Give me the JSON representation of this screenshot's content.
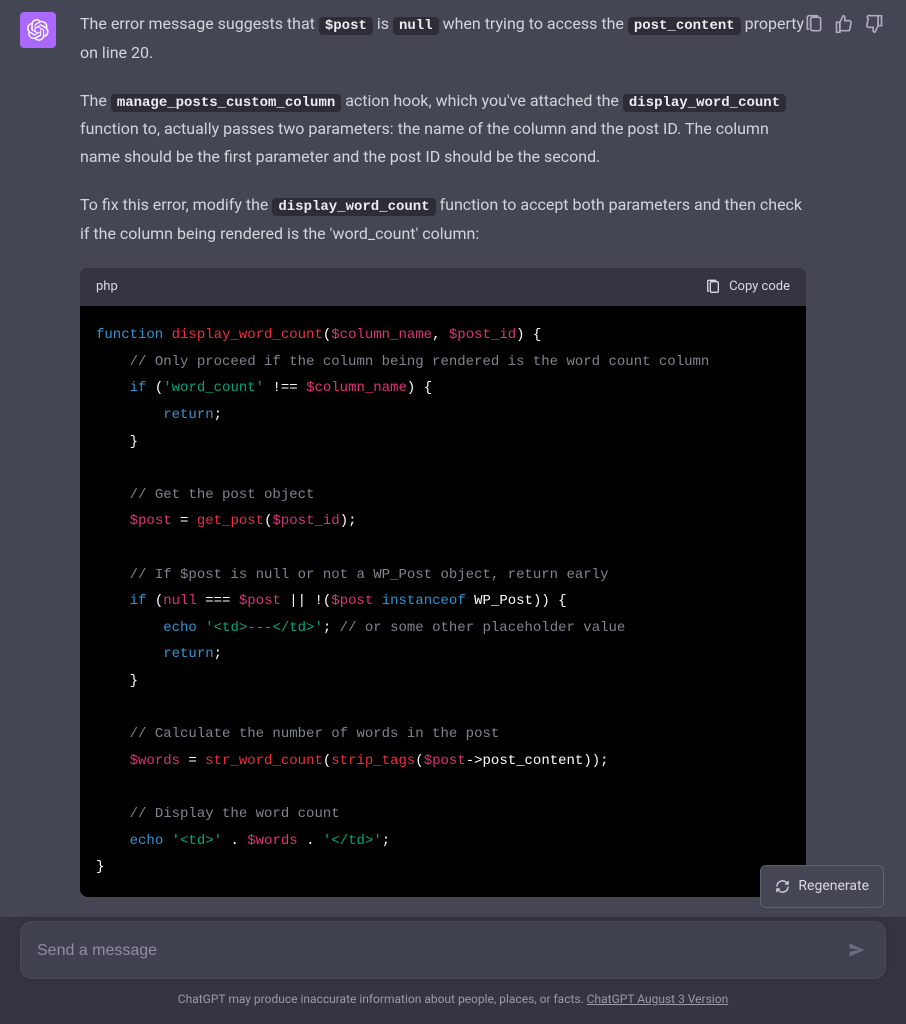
{
  "message": {
    "p1_a": "The error message suggests that ",
    "p1_code1": "$post",
    "p1_b": " is ",
    "p1_code2": "null",
    "p1_c": " when trying to access the ",
    "p1_code3": "post_content",
    "p1_d": " property on line 20.",
    "p2_a": "The ",
    "p2_code1": "manage_posts_custom_column",
    "p2_b": " action hook, which you've attached the ",
    "p2_code2": "display_word_count",
    "p2_c": " function to, actually passes two parameters: the name of the column and the post ID. The column name should be the first parameter and the post ID should be the second.",
    "p3_a": "To fix this error, modify the ",
    "p3_code1": "display_word_count",
    "p3_b": " function to accept both parameters and then check if the column being rendered is the 'word_count' column:"
  },
  "code_block": {
    "language": "php",
    "copy_label": "Copy code",
    "tokens": {
      "l1_kw": "function",
      "l1_fn": "display_word_count",
      "l1_v1": "$column_name",
      "l1_v2": "$post_id",
      "l2_cm": "// Only proceed if the column being rendered is the word count column",
      "l3_kw": "if",
      "l3_str": "'word_count'",
      "l3_var": "$column_name",
      "l4_kw": "return",
      "l6_cm": "// Get the post object",
      "l7_v1": "$post",
      "l7_fn": "get_post",
      "l7_v2": "$post_id",
      "l8_cm": "// If $post is null or not a WP_Post object, return early",
      "l9_kw": "if",
      "l9_null": "null",
      "l9_v1": "$post",
      "l9_v2": "$post",
      "l9_iof": "instanceof",
      "l9_cls": "WP_Post",
      "l10_echo": "echo",
      "l10_str": "'<td>---</td>'",
      "l10_cm": "// or some other placeholder value",
      "l11_kw": "return",
      "l13_cm": "// Calculate the number of words in the post",
      "l14_v1": "$words",
      "l14_fn1": "str_word_count",
      "l14_fn2": "strip_tags",
      "l14_v2": "$post",
      "l14_prop": "->post_content",
      "l15_cm": "// Display the word count",
      "l16_echo": "echo",
      "l16_s1": "'<td>'",
      "l16_v": "$words",
      "l16_s2": "'</td>'"
    }
  },
  "input": {
    "placeholder": "Send a message"
  },
  "regenerate": {
    "label": "Regenerate"
  },
  "footer": {
    "text": "ChatGPT may produce inaccurate information about people, places, or facts. ",
    "link": "ChatGPT August 3 Version"
  }
}
